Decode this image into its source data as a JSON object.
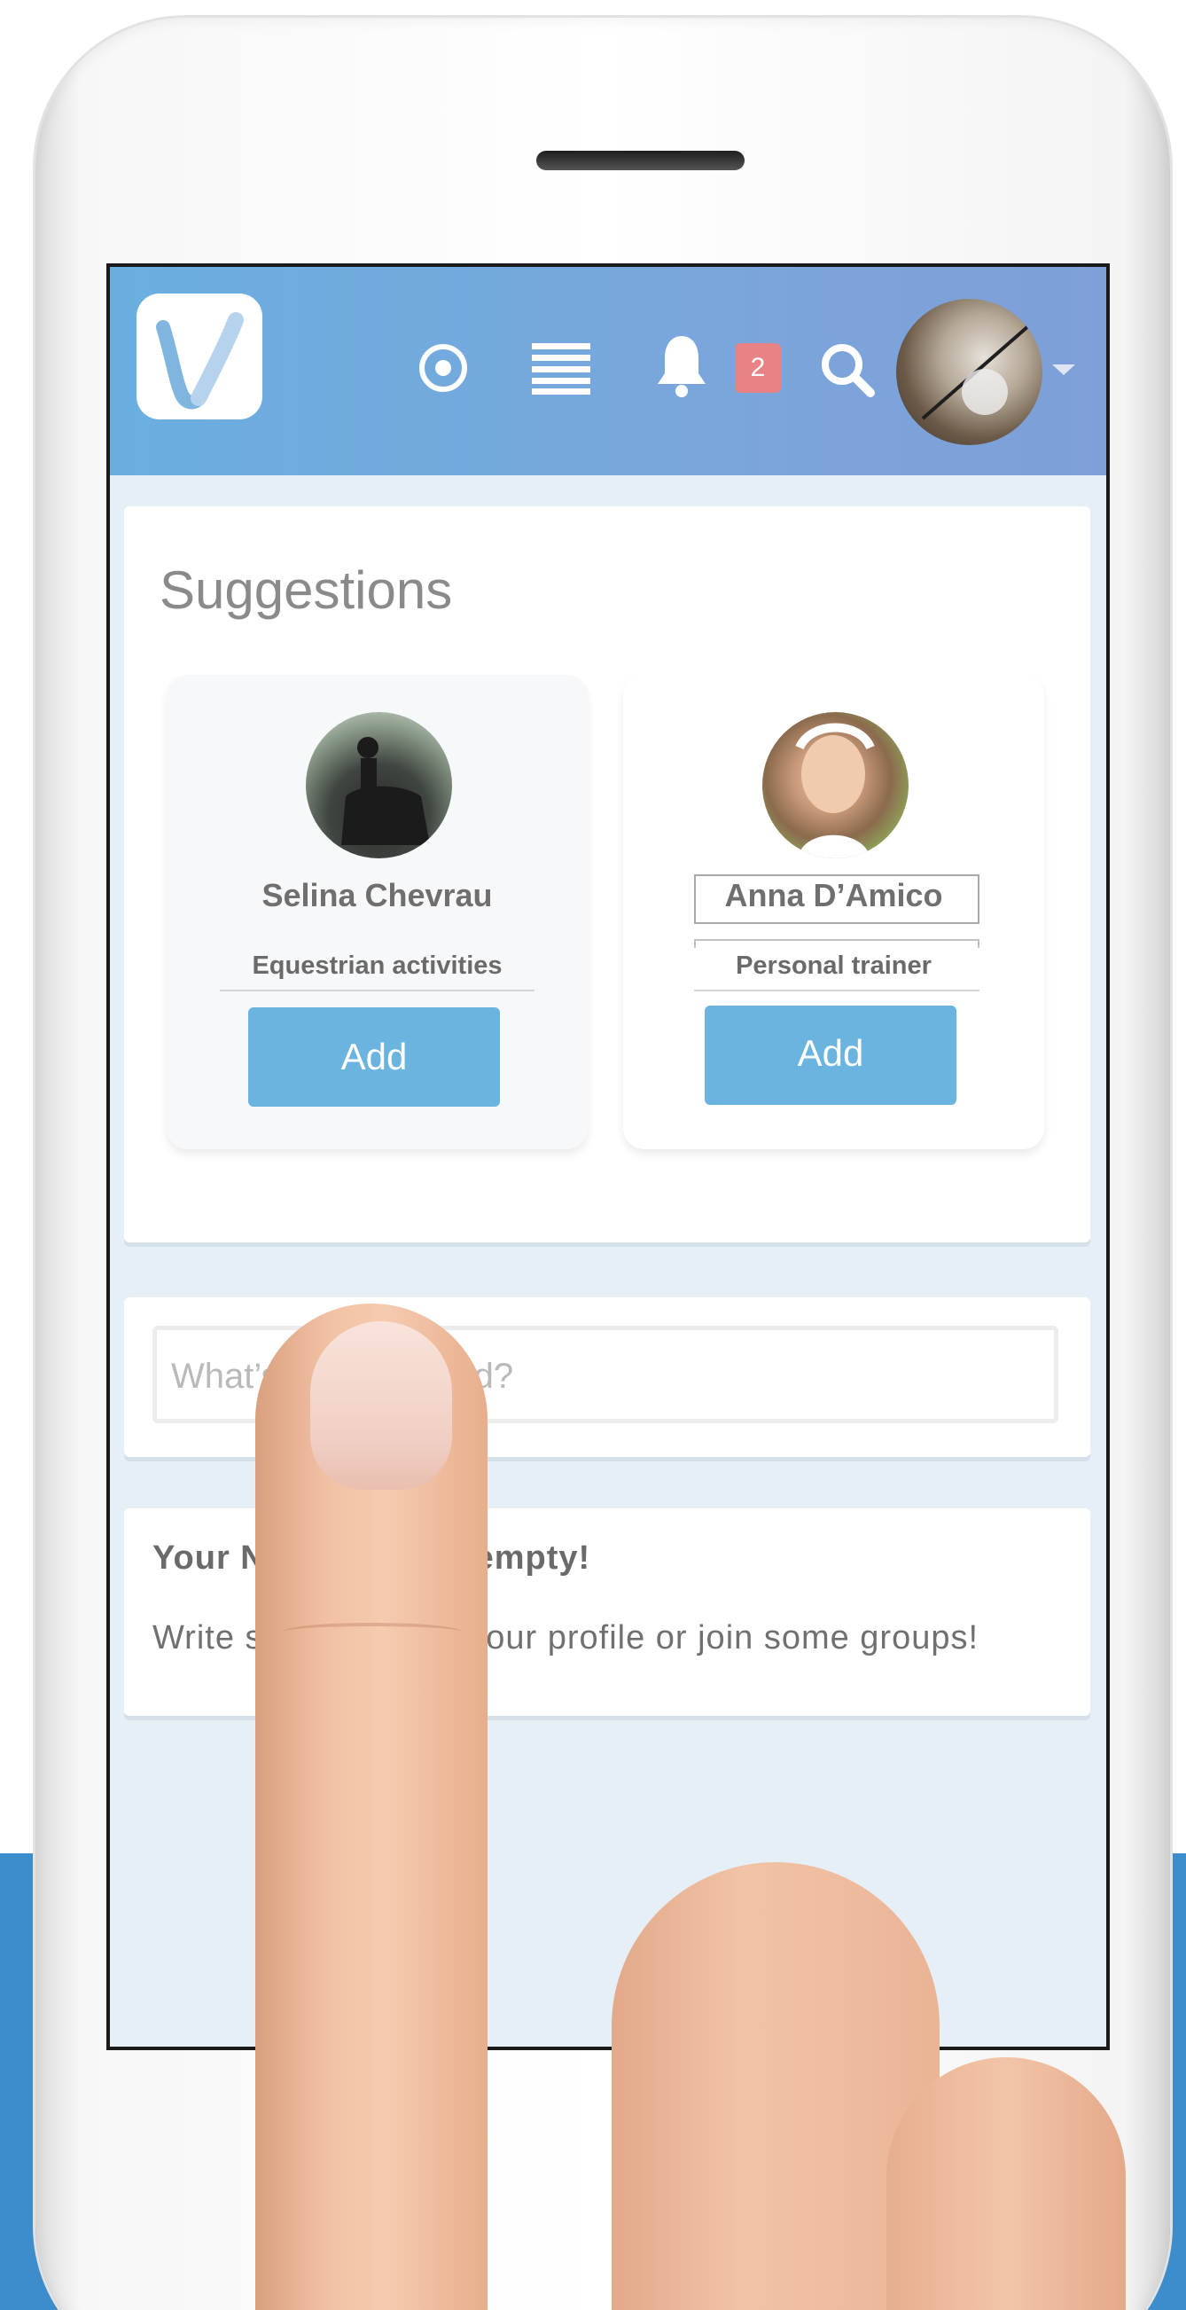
{
  "header": {
    "notification_count": "2"
  },
  "suggestions": {
    "title": "Suggestions",
    "people": [
      {
        "name": "Selina Chevrau",
        "role": "Equestrian activities",
        "add_label": "Add"
      },
      {
        "name": "Anna D’Amico",
        "role": "Personal trainer",
        "add_label": "Add"
      }
    ]
  },
  "composer": {
    "placeholder": "What’s on your mind?"
  },
  "feed": {
    "empty_title": "Your News Feed is empty!",
    "empty_text": "Write something on your profile or join some groups!"
  },
  "colors": {
    "header_gradient_start": "#6aaee0",
    "header_gradient_end": "#7f9fd8",
    "button": "#6ab4df",
    "badge": "#e98284",
    "page_band": "#3d8ccb"
  },
  "icons": [
    "app-logo-icon",
    "target-icon",
    "menu-icon",
    "bell-icon",
    "search-icon",
    "caret-down-icon"
  ]
}
